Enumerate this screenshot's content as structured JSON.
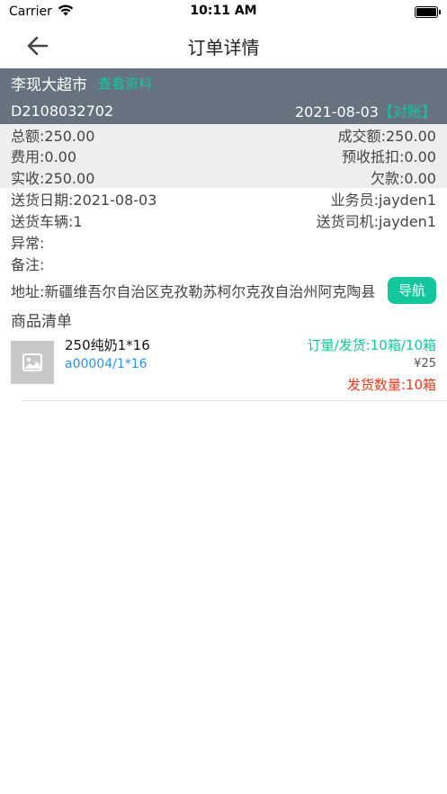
{
  "status_bar": {
    "carrier": "Carrier",
    "time": "10:11 AM"
  },
  "nav": {
    "title": "订单详情"
  },
  "header": {
    "customer_name": "李现大超市",
    "view_profile_link": "查看资料",
    "order_no": "D2108032702",
    "order_date": "2021-08-03",
    "reconcile_link": "【对账】"
  },
  "summary": {
    "total": "总额:250.00",
    "deal_amount": "成交额:250.00",
    "fee": "费用:0.00",
    "prepaid_deduct": "预收抵扣:0.00",
    "received": "实收:250.00",
    "owed": "欠款:0.00"
  },
  "info": {
    "delivery_date": "送货日期:2021-08-03",
    "salesman": "业务员:jayden1",
    "vehicle": "送货车辆:1",
    "driver": "送货司机:jayden1",
    "exception": "异常:",
    "remark": "备注:"
  },
  "address": {
    "text": "地址:新疆维吾尔自治区克孜勒苏柯尔克孜自治州阿克陶县",
    "nav_button": "导航"
  },
  "goods_section": {
    "title": "商品清单",
    "items": [
      {
        "name": "250纯奶1*16",
        "code": "a00004/1*16",
        "order_qty": "订量/发货:10箱/10箱",
        "price": "¥25",
        "ship_qty": "发货数量:10箱"
      }
    ]
  },
  "colors": {
    "header_bg": "#66737f",
    "accent_green": "#13c79d",
    "link_blue": "#2f8fe6",
    "alert_red": "#e53a1c"
  }
}
